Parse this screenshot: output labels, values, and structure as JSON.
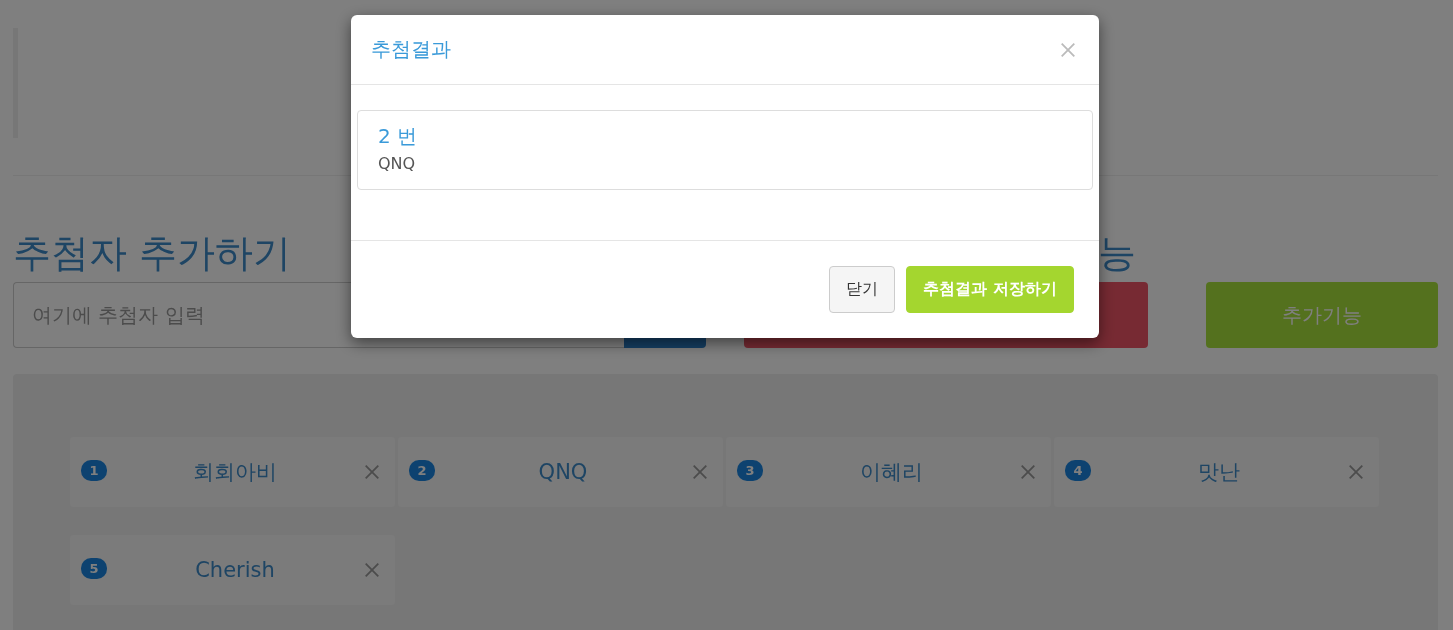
{
  "page": {
    "heading": "추첨자 추가하기",
    "heading_2": "능",
    "input": {
      "placeholder": "여기에 추첨자 입력"
    },
    "extra_button": "추가기능",
    "entrants": [
      {
        "number": "1",
        "name": "회회아비"
      },
      {
        "number": "2",
        "name": "QNQ"
      },
      {
        "number": "3",
        "name": "이혜리"
      },
      {
        "number": "4",
        "name": "맛난"
      },
      {
        "number": "5",
        "name": "Cherish"
      }
    ]
  },
  "modal": {
    "title": "추첨결과",
    "result": {
      "number": "2 번",
      "name": "QNQ"
    },
    "buttons": [
      {
        "label": "닫기",
        "kind": "default"
      },
      {
        "label": "추첨결과 저장하기",
        "kind": "primary"
      }
    ]
  }
}
